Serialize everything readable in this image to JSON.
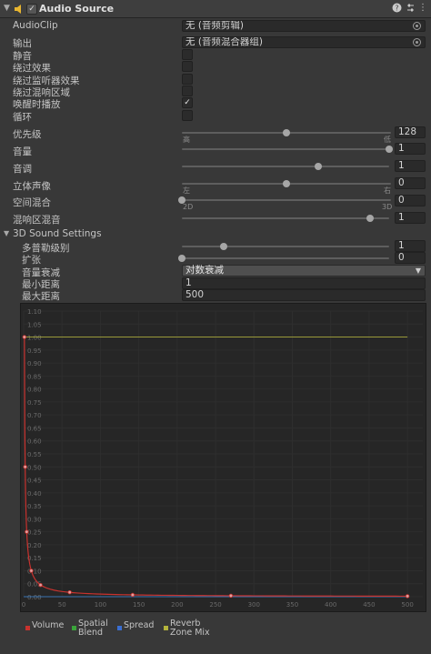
{
  "header": {
    "title": "Audio Source",
    "fold_icon": "caret-down-icon",
    "speaker_icon": "speaker-icon",
    "enabled": true,
    "actions": [
      "help-icon",
      "preset-icon",
      "more-icon"
    ]
  },
  "audio_clip": {
    "label": "AudioClip",
    "value": "无 (音频剪辑)"
  },
  "output": {
    "label": "输出",
    "value": "无 (音频混合器组)"
  },
  "toggles": [
    {
      "label": "静音",
      "checked": false
    },
    {
      "label": "绕过效果",
      "checked": false
    },
    {
      "label": "绕过监听器效果",
      "checked": false
    },
    {
      "label": "绕过混响区域",
      "checked": false
    },
    {
      "label": "唤醒时播放",
      "checked": true
    },
    {
      "label": "循环",
      "checked": false
    }
  ],
  "priority": {
    "label": "优先级",
    "value": "128",
    "level": 0.5,
    "min_label": "高",
    "max_label": "低"
  },
  "volume": {
    "label": "音量",
    "value": "1",
    "level": 1.0
  },
  "pitch": {
    "label": "音调",
    "value": "1",
    "level": 0.66
  },
  "stereo_pan": {
    "label": "立体声像",
    "value": "0",
    "level": 0.5,
    "min_label": "左",
    "max_label": "右"
  },
  "spatial_blend": {
    "label": "空间混合",
    "value": "0",
    "level": 0.0,
    "min_label": "2D",
    "max_label": "3D"
  },
  "reverb_mix": {
    "label": "混响区混音",
    "value": "1",
    "level": 0.91
  },
  "sound3d": {
    "section": "3D Sound Settings",
    "doppler": {
      "label": "多普勒级别",
      "value": "1",
      "level": 0.2
    },
    "spread": {
      "label": "扩张",
      "value": "0",
      "level": 0.0
    },
    "rolloff": {
      "label": "音量衰减",
      "value": "对数衰减"
    },
    "min_distance": {
      "label": "最小距离",
      "value": "1"
    },
    "max_distance": {
      "label": "最大距离",
      "value": "500"
    }
  },
  "chart_data": {
    "type": "line",
    "x_ticks": [
      "0",
      "50",
      "100",
      "150",
      "200",
      "250",
      "300",
      "350",
      "400",
      "450",
      "500"
    ],
    "y_ticks": [
      "0.00",
      "0.05",
      "0.10",
      "0.15",
      "0.20",
      "0.25",
      "0.30",
      "0.35",
      "0.40",
      "0.45",
      "0.50",
      "0.55",
      "0.60",
      "0.65",
      "0.70",
      "0.75",
      "0.80",
      "0.85",
      "0.90",
      "0.95",
      "1.00",
      "1.05",
      "1.10"
    ],
    "xlim": [
      0,
      520
    ],
    "ylim": [
      0,
      1.1
    ],
    "colors": {
      "volume": "#c8322e",
      "spatial": "#3aa43a",
      "spread": "#3a6ed2",
      "reverb": "#b4b43c"
    },
    "series": [
      {
        "name": "Volume",
        "x": [
          1,
          2,
          5,
          10,
          20,
          50,
          100,
          200,
          300,
          400,
          500
        ],
        "values": [
          1.0,
          0.5,
          0.2,
          0.1,
          0.05,
          0.02,
          0.01,
          0.005,
          0.0033,
          0.0025,
          0.002
        ]
      },
      {
        "name": "Spatial Blend",
        "x": [
          0,
          500
        ],
        "values": [
          0,
          0
        ]
      },
      {
        "name": "Spread",
        "x": [
          0,
          500
        ],
        "values": [
          0,
          0
        ]
      },
      {
        "name": "Reverb Zone Mix",
        "x": [
          0,
          500
        ],
        "values": [
          1,
          1
        ]
      }
    ],
    "key_points": {
      "volume": {
        "x": [
          1,
          2,
          4,
          10,
          22,
          60,
          142,
          270,
          500
        ],
        "values": [
          1.0,
          0.5,
          0.25,
          0.1,
          0.045,
          0.017,
          0.007,
          0.0037,
          0.002
        ]
      }
    },
    "legend": [
      "Volume",
      "Spatial\nBlend",
      "Spread",
      "Reverb\nZone Mix"
    ]
  }
}
